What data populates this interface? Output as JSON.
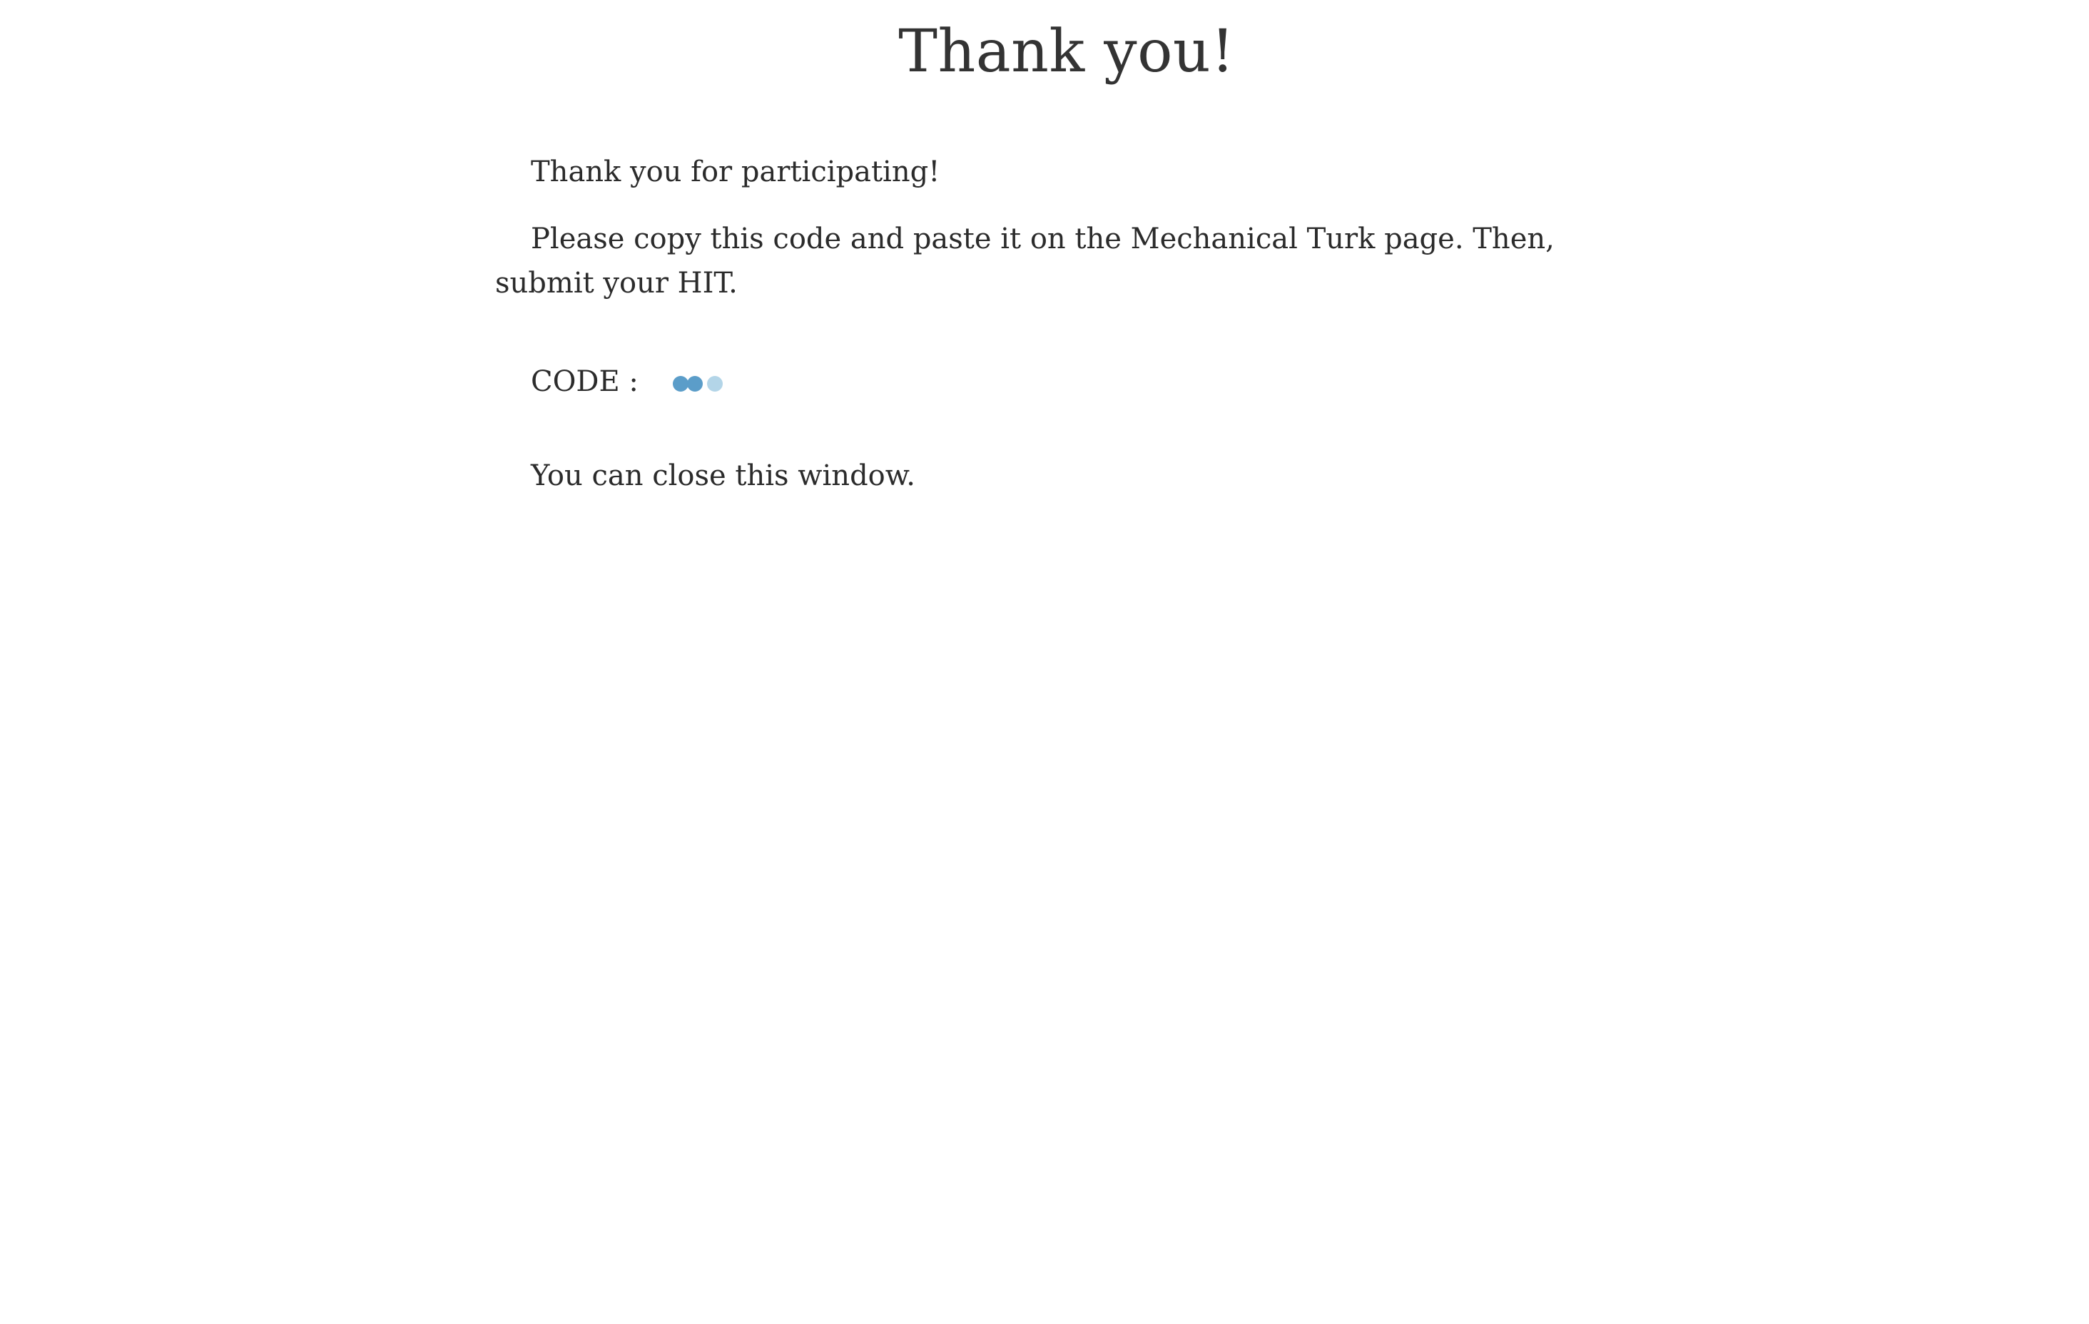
{
  "page": {
    "title": "Thank you!",
    "messages": {
      "participation": "Thank you for participating!",
      "instructions": "Please copy this code and paste it on the Mechanical Turk page. Then, submit your HIT.",
      "code_label": "CODE :",
      "close_note": "You can close this window."
    },
    "code_loading_icon": "loading-dots-icon",
    "colors": {
      "text": "#2b2b2b",
      "loader_dark": "#5b9dc9",
      "loader_light": "#b3d5e8",
      "background": "#ffffff"
    }
  }
}
